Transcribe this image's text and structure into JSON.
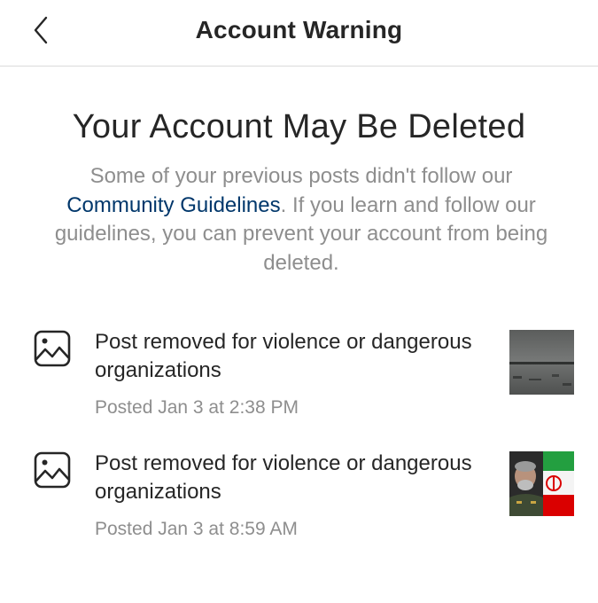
{
  "header": {
    "title": "Account Warning",
    "back_icon": "chevron-left-icon"
  },
  "main": {
    "title": "Your Account May Be Deleted",
    "description_part1": "Some of your previous posts didn't follow our ",
    "description_link": "Community Guidelines",
    "description_part2": ". If you learn and follow our guidelines, you can prevent your account from being deleted."
  },
  "posts": [
    {
      "icon": "image-icon",
      "text": "Post removed for violence or dangerous organizations",
      "date": "Posted Jan 3 at 2:38 PM"
    },
    {
      "icon": "image-icon",
      "text": "Post removed for violence or dangerous organizations",
      "date": "Posted Jan 3 at 8:59 AM"
    }
  ],
  "colors": {
    "text_primary": "#262626",
    "text_secondary": "#8e8e8e",
    "link": "#00376b",
    "divider": "#dbdbdb"
  }
}
